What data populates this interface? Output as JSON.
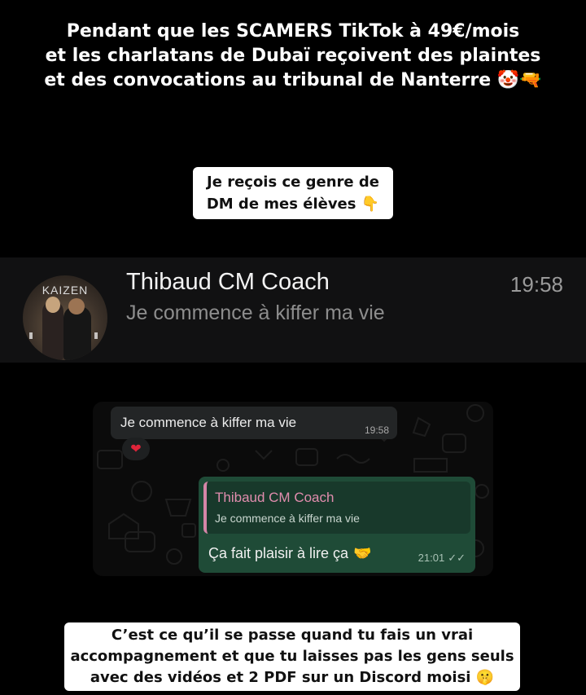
{
  "headline": {
    "line1": "Pendant que les SCAMERS TikTok à 49€/mois",
    "line2": "et les charlatans de Dubaï reçoivent des plaintes",
    "line3": "et des convocations au tribunal de Nanterre",
    "emojis": "🤡🔫"
  },
  "sticker_top": {
    "line1": "Je reçois ce genre de",
    "line2": "DM de mes élèves",
    "emoji": "👇"
  },
  "chat_list_item": {
    "avatar_text": "KAIZEN",
    "name": "Thibaud CM Coach",
    "preview": "Je commence à kiffer ma vie",
    "time": "19:58"
  },
  "conversation": {
    "incoming": {
      "text": "Je commence à kiffer ma vie",
      "time": "19:58",
      "reaction": "❤"
    },
    "outgoing": {
      "quote_name": "Thibaud CM Coach",
      "quote_text": "Je commence à kiffer ma vie",
      "text": "Ça fait plaisir à lire ça",
      "emoji": "🤝",
      "time": "21:01",
      "status_icon": "✓✓"
    }
  },
  "sticker_bottom": {
    "line1": "C’est ce qu’il se passe quand tu fais un vrai",
    "line2": "accompagnement et que tu laisses pas les gens seuls",
    "line3": "avec des vidéos et 2 PDF sur un Discord moisi",
    "emoji": "🤫"
  }
}
